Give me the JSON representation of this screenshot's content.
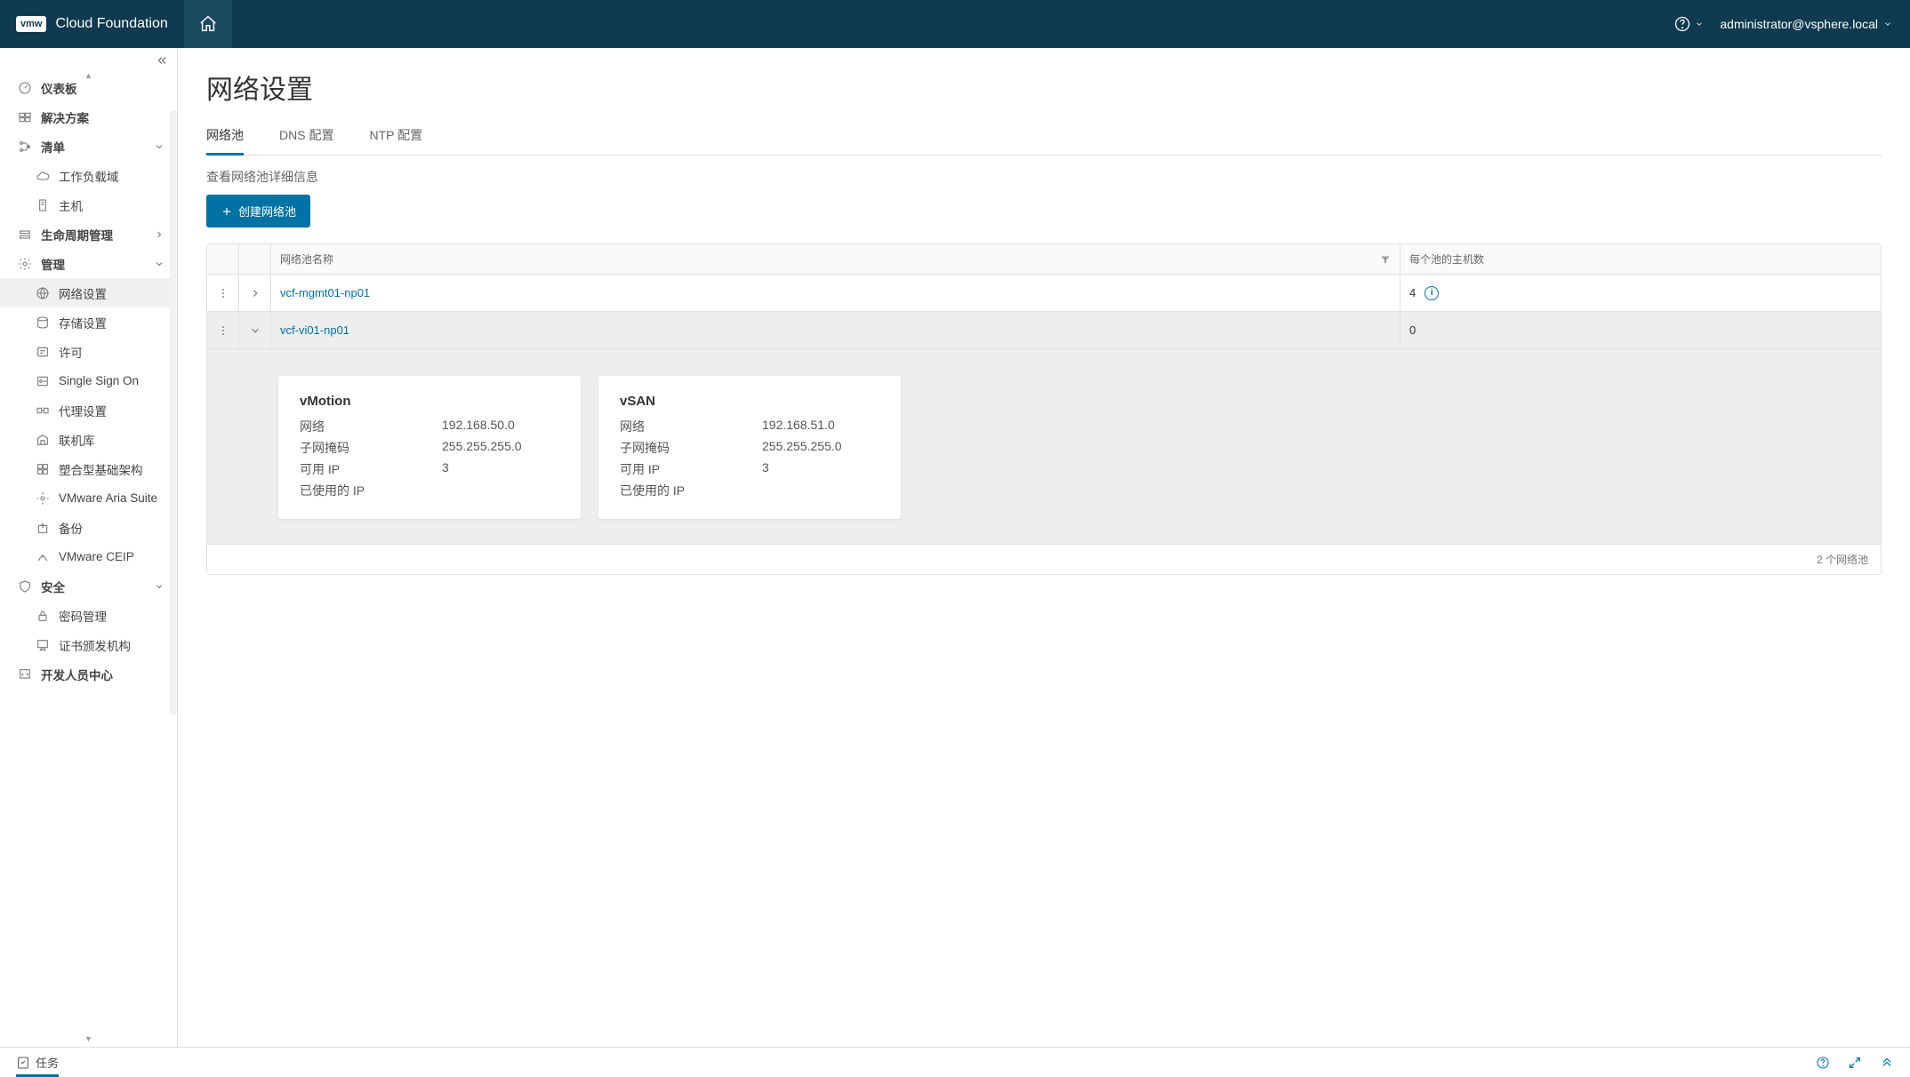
{
  "header": {
    "logo_text": "vmw",
    "product": "Cloud Foundation",
    "user": "administrator@vsphere.local"
  },
  "sidebar": {
    "items": [
      {
        "label": "仪表板",
        "icon": "dashboard",
        "bold": true
      },
      {
        "label": "解决方案",
        "icon": "solutions",
        "bold": true
      },
      {
        "label": "清单",
        "icon": "inventory",
        "bold": true,
        "expand": "down"
      },
      {
        "label": "工作负载域",
        "icon": "cloud",
        "sub": true
      },
      {
        "label": "主机",
        "icon": "host",
        "sub": true
      },
      {
        "label": "生命周期管理",
        "icon": "lifecycle",
        "bold": true,
        "expand": "right"
      },
      {
        "label": "管理",
        "icon": "gear",
        "bold": true,
        "expand": "down"
      },
      {
        "label": "网络设置",
        "icon": "network",
        "sub": true,
        "active": true
      },
      {
        "label": "存储设置",
        "icon": "storage",
        "sub": true
      },
      {
        "label": "许可",
        "icon": "license",
        "sub": true
      },
      {
        "label": "Single Sign On",
        "icon": "sso",
        "sub": true
      },
      {
        "label": "代理设置",
        "icon": "proxy",
        "sub": true
      },
      {
        "label": "联机库",
        "icon": "depot",
        "sub": true
      },
      {
        "label": "塑合型基础架构",
        "icon": "composable",
        "sub": true
      },
      {
        "label": "VMware Aria Suite",
        "icon": "aria",
        "sub": true
      },
      {
        "label": "备份",
        "icon": "backup",
        "sub": true
      },
      {
        "label": "VMware CEIP",
        "icon": "ceip",
        "sub": true
      },
      {
        "label": "安全",
        "icon": "shield",
        "bold": true,
        "expand": "down"
      },
      {
        "label": "密码管理",
        "icon": "lock",
        "sub": true
      },
      {
        "label": "证书颁发机构",
        "icon": "cert",
        "sub": true
      },
      {
        "label": "开发人员中心",
        "icon": "dev",
        "bold": true
      }
    ]
  },
  "page": {
    "title": "网络设置",
    "tabs": [
      "网络池",
      "DNS 配置",
      "NTP 配置"
    ],
    "active_tab": 0,
    "subtitle": "查看网络池详细信息",
    "create_btn": "创建网络池",
    "columns": {
      "name": "网络池名称",
      "hosts": "每个池的主机数"
    },
    "rows": [
      {
        "name": "vcf-mgmt01-np01",
        "hosts": "4",
        "info": true,
        "expanded": false
      },
      {
        "name": "vcf-vi01-np01",
        "hosts": "0",
        "expanded": true,
        "details": [
          {
            "title": "vMotion",
            "lines": [
              {
                "label": "网络",
                "value": "192.168.50.0"
              },
              {
                "label": "子网掩码",
                "value": "255.255.255.0"
              },
              {
                "label": "可用 IP",
                "value": "3"
              },
              {
                "label": "已使用的 IP",
                "value": ""
              }
            ]
          },
          {
            "title": "vSAN",
            "lines": [
              {
                "label": "网络",
                "value": "192.168.51.0"
              },
              {
                "label": "子网掩码",
                "value": "255.255.255.0"
              },
              {
                "label": "可用 IP",
                "value": "3"
              },
              {
                "label": "已使用的 IP",
                "value": ""
              }
            ]
          }
        ]
      }
    ],
    "footer": "2 个网络池"
  },
  "bottombar": {
    "tasks": "任务"
  }
}
